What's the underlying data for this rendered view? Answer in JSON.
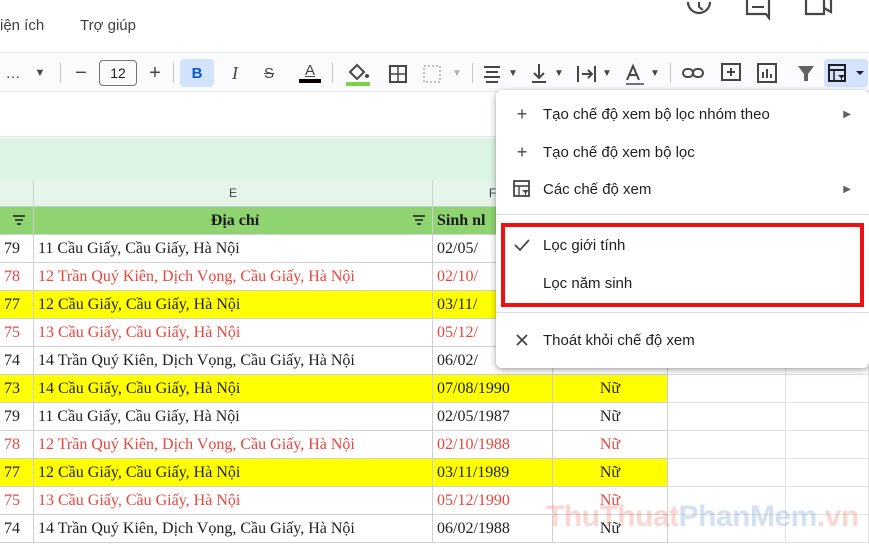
{
  "menubar": {
    "items": [
      "iện ích",
      "Trợ giúp"
    ]
  },
  "toolbar": {
    "font_size": "12",
    "bold_label": "B",
    "italic_label": "I",
    "strike_label": "S",
    "text_color_label": "A",
    "minus_label": "−",
    "plus_label": "+"
  },
  "columns": {
    "e_header": "E",
    "f_header": "F"
  },
  "table": {
    "headers": {
      "address": "Địa chỉ",
      "birth": "Sinh nl"
    },
    "rows": [
      {
        "num": "79",
        "address": "11 Cầu Giấy, Cầu Giấy, Hà Nội",
        "birth": "02/05/",
        "gender": "",
        "style": "normal"
      },
      {
        "num": "78",
        "address": "12 Trần Quý Kiên, Dịch Vọng, Cầu Giấy, Hà Nội",
        "birth": "02/10/",
        "gender": "",
        "style": "red"
      },
      {
        "num": "77",
        "address": "12 Cầu Giấy, Cầu Giấy, Hà Nội",
        "birth": "03/11/",
        "gender": "",
        "style": "yellow"
      },
      {
        "num": "75",
        "address": "13 Cầu Giấy, Cầu Giấy, Hà Nội",
        "birth": "05/12/",
        "gender": "",
        "style": "red"
      },
      {
        "num": "74",
        "address": "14 Trần Quý Kiên, Dịch Vọng, Cầu Giấy, Hà Nội",
        "birth": "06/02/",
        "gender": "",
        "style": "normal"
      },
      {
        "num": "73",
        "address": "14 Cầu Giấy, Cầu Giấy, Hà Nội",
        "birth": "07/08/1990",
        "gender": "Nữ",
        "style": "yellow"
      },
      {
        "num": "79",
        "address": "11 Cầu Giấy, Cầu Giấy, Hà Nội",
        "birth": "02/05/1987",
        "gender": "Nữ",
        "style": "normal"
      },
      {
        "num": "78",
        "address": "12 Trần Quý Kiên, Dịch Vọng, Cầu Giấy, Hà Nội",
        "birth": "02/10/1988",
        "gender": "Nữ",
        "style": "red"
      },
      {
        "num": "77",
        "address": "12 Cầu Giấy, Cầu Giấy, Hà Nội",
        "birth": "03/11/1989",
        "gender": "Nữ",
        "style": "yellow"
      },
      {
        "num": "75",
        "address": "13 Cầu Giấy, Cầu Giấy, Hà Nội",
        "birth": "05/12/1990",
        "gender": "Nữ",
        "style": "red"
      },
      {
        "num": "74",
        "address": "14 Trần Quý Kiên, Dịch Vọng, Cầu Giấy, Hà Nội",
        "birth": "06/02/1988",
        "gender": "Nữ",
        "style": "normal"
      }
    ]
  },
  "menu": {
    "create_group_view": "Tạo chế độ xem bộ lọc nhóm theo",
    "create_view": "Tạo chế độ xem bộ lọc",
    "views": "Các chế độ xem",
    "filter_gender": "Lọc giới tính",
    "filter_birth_year": "Lọc năm sinh",
    "exit_view": "Thoát khỏi chế độ xem"
  },
  "watermark": {
    "part1": "ThuThuat",
    "part2": "PhanMem",
    "part3": ".vn"
  },
  "colors": {
    "header_green": "#8fd470",
    "yellow_fill": "#ffff00",
    "red_text": "#e8453c",
    "highlight_border": "#ee1111"
  }
}
